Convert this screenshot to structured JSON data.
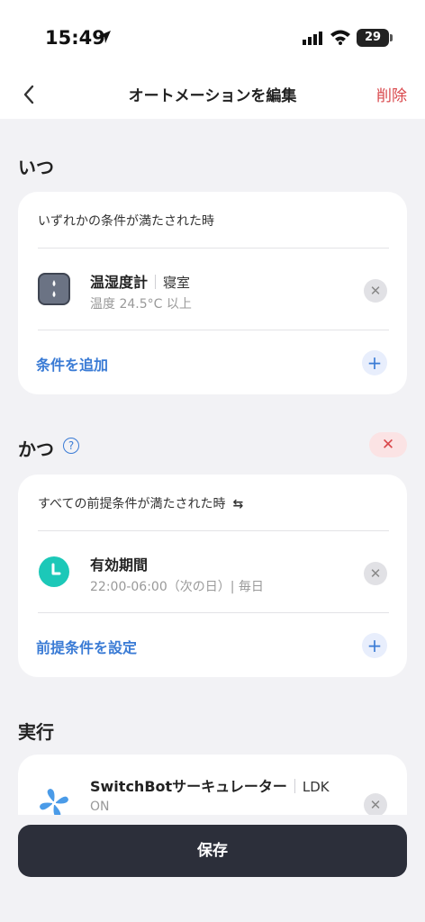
{
  "status": {
    "time": "15:49",
    "battery": "29"
  },
  "nav": {
    "title": "オートメーションを編集",
    "delete_label": "削除"
  },
  "when": {
    "title": "いつ",
    "header": "いずれかの条件が満たされた時",
    "item": {
      "name": "温湿度計",
      "room": "寝室",
      "detail": "温度 24.5°C 以上"
    },
    "add_label": "条件を追加"
  },
  "and": {
    "title": "かつ",
    "header": "すべての前提条件が満たされた時",
    "swap_symbol": "⇆",
    "item": {
      "name": "有効期間",
      "detail": "22:00-06:00（次の日）| 毎日"
    },
    "set_label": "前提条件を設定"
  },
  "exec": {
    "title": "実行",
    "item": {
      "name": "SwitchBotサーキュレーター",
      "room": "LDK",
      "state": "ON"
    }
  },
  "save_label": "保存",
  "colors": {
    "accent": "#3a7bd5",
    "danger": "#d9474b",
    "save_bg": "#2c2f3a",
    "clock_teal": "#1cc8b8"
  }
}
